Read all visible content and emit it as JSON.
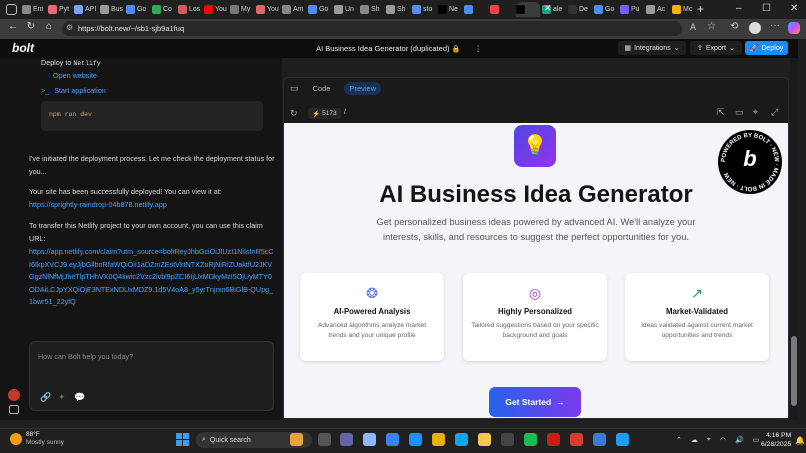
{
  "browser": {
    "tabs": [
      {
        "label": "Em",
        "color": "#8a8a8a"
      },
      {
        "label": "Pyt",
        "color": "#e06c75"
      },
      {
        "label": "API",
        "color": "#7aa2f7"
      },
      {
        "label": "Bus",
        "color": "#999999"
      },
      {
        "label": "Go",
        "color": "#4f8cf0"
      },
      {
        "label": "Co",
        "color": "#34a853"
      },
      {
        "label": "Los",
        "color": "#d05c5c"
      },
      {
        "label": "You",
        "color": "#ff0000"
      },
      {
        "label": "My",
        "color": "#777777"
      },
      {
        "label": "You",
        "color": "#d66"
      },
      {
        "label": "Am",
        "color": "#888888"
      },
      {
        "label": "Go",
        "color": "#4f8cf0"
      },
      {
        "label": "Un",
        "color": "#999999"
      },
      {
        "label": "Sh",
        "color": "#888888"
      },
      {
        "label": "Sh",
        "color": "#999999"
      },
      {
        "label": "sto",
        "color": "#5b8def"
      },
      {
        "label": "Ne",
        "color": "#000000"
      },
      {
        "label": "",
        "color": "#4f8cf0"
      },
      {
        "label": "",
        "color": "#e44"
      },
      {
        "label": "",
        "color": "#000000"
      },
      {
        "label": "ale",
        "color": "#1aa37a"
      },
      {
        "label": "De",
        "color": "#333"
      },
      {
        "label": "Go",
        "color": "#4f8cf0"
      },
      {
        "label": "Pu",
        "color": "#7b5cff"
      },
      {
        "label": "Ac",
        "color": "#999"
      },
      {
        "label": "Mc",
        "color": "#f4b400"
      }
    ],
    "url": "https://bolt.new/~/sb1-sjb9a1fuq"
  },
  "bolt": {
    "logo": "bolt",
    "project_title": "AI Business Idea Generator (duplicated)",
    "integrations_label": "Integrations",
    "export_label": "Export",
    "deploy_label": "Deploy"
  },
  "chat": {
    "deploy_to": "Deploy to",
    "netlify": "Netlify",
    "open_website": "Open website",
    "start_application": "Start application",
    "command": "npm run dev",
    "msg1": "I've initiated the deployment process. Let me check the deployment status for you...",
    "msg2": "Your site has been successfully deployed! You can view it at:",
    "site_link": "https://sprightly-raindrop-04b878.netlify.app",
    "msg3": "To transfer this Netlify project to your own account, you can use  this claim URL:",
    "claim_link": "https://app.netlify.com/claim?utm_source=boltReyJhbGciOiJIUzI1NiIsInR5cCI6IkpXVCJ9.eyJjbGllbnRfaWQiOiI1aDZmZEstVktNTXZuRjNiRlZUaktfU2JKVGgzNlNfMjJheTlpTHhVX0Q4Iiwic2Vzc2lvbl9pZCI6IjUxMDkyMzI5OjUyMTY0ODAiLCJpYXQiOjE3NTExNDUxMDZ9.1d5V4oA8_y5yrTnjrxn6BiGlB-QUpg_1bwr51_22yfQ",
    "input_placeholder": "How can Bolt help you today?"
  },
  "preview": {
    "code_tab": "Code",
    "preview_tab": "Preview",
    "port": "5173",
    "path": "/",
    "badge_text": "POWERED BY BOLT · NEW · MADE IN BOLT · NEW",
    "hero_title": "AI Business Idea Generator",
    "hero_sub": "Get personalized business ideas powered by advanced AI. We'll analyze your interests, skills, and resources to suggest the perfect opportunities for you.",
    "cards": [
      {
        "title": "AI-Powered Analysis",
        "desc": "Advanced algorithms analyze market trends and your unique profile",
        "icon": "brain-icon",
        "color": "#4f6ef7"
      },
      {
        "title": "Highly Personalized",
        "desc": "Tailored suggestions based on your specific background and goals",
        "icon": "target-icon",
        "color": "#9b3df2"
      },
      {
        "title": "Market-Validated",
        "desc": "Ideas validated against current market opportunities and trends",
        "icon": "trending-up-icon",
        "color": "#16a34a"
      }
    ],
    "cta": "Get Started"
  },
  "taskbar": {
    "weather_temp": "88°F",
    "weather_desc": "Mostly sunny",
    "search_placeholder": "Quick search",
    "time": "4:16 PM",
    "date": "6/28/2025"
  }
}
